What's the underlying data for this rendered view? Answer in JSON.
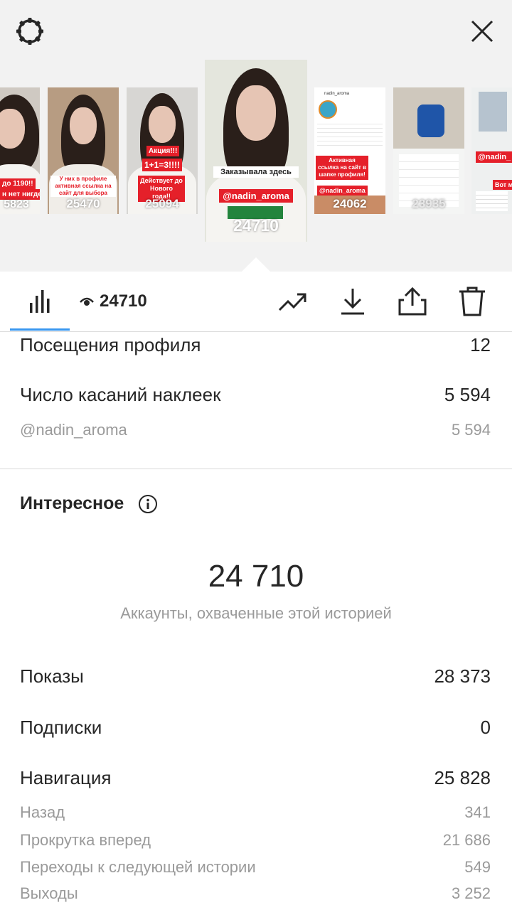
{
  "header": {
    "settings_icon": "gear-icon",
    "close_icon": "close-icon"
  },
  "stories": [
    {
      "views": "5823",
      "text": "до 1190!!",
      "text2": "н нет нигде!"
    },
    {
      "views": "25470",
      "text": "У них в профиле активная ссылка на сайт для выбора"
    },
    {
      "views": "25094",
      "text": "Акция!!!",
      "text2": "1+1=3!!!!",
      "text3": "Действует до Нового года!!"
    },
    {
      "views": "24710",
      "text": "Заказывала здесь",
      "text2": "@nadin_aroma"
    },
    {
      "views": "24062",
      "text": "nadin_aroma",
      "text2": "Активная ссылка на сайт в шапке профиля!",
      "text3": "@nadin_aroma"
    },
    {
      "views": "23935"
    },
    {
      "views": "",
      "text": "@nadin_",
      "text2": "Вот м"
    }
  ],
  "toolbar": {
    "views": "24710",
    "insights_icon": "bar-chart-icon",
    "eye_icon": "eye-icon",
    "promote_icon": "trend-icon",
    "download_icon": "download-icon",
    "share_icon": "share-icon",
    "delete_icon": "trash-icon"
  },
  "stats": {
    "profile_visits_label": "Посещения профиля",
    "profile_visits_value": "12",
    "sticker_taps_label": "Число касаний наклеек",
    "sticker_taps_value": "5 594",
    "sticker_account_label": "@nadin_aroma",
    "sticker_account_value": "5 594"
  },
  "discovery": {
    "title": "Интересное",
    "info_icon": "info-icon",
    "reach_value": "24 710",
    "reach_label": "Аккаунты, охваченные этой историей",
    "impressions_label": "Показы",
    "impressions_value": "28 373",
    "follows_label": "Подписки",
    "follows_value": "0",
    "navigation_label": "Навигация",
    "navigation_value": "25 828",
    "back_label": "Назад",
    "back_value": "341",
    "forward_label": "Прокрутка вперед",
    "forward_value": "21 686",
    "next_story_label": "Переходы к следующей истории",
    "next_story_value": "549",
    "exits_label": "Выходы",
    "exits_value": "3 252"
  },
  "colors": {
    "accent": "#3897f0",
    "label_red": "#e5202a"
  }
}
